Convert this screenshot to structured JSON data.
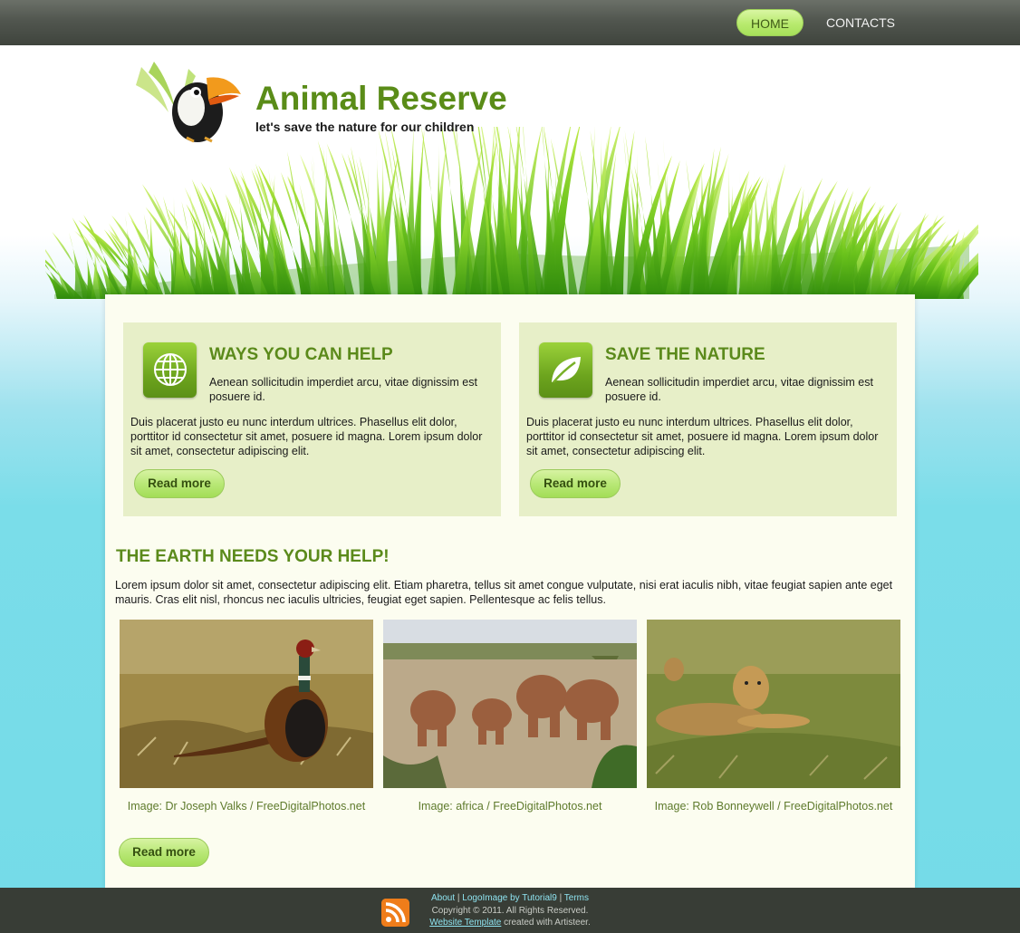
{
  "nav": {
    "home": "HOME",
    "contacts": "CONTACTS"
  },
  "header": {
    "title": "Animal Reserve",
    "slogan": "let's save the nature for our children",
    "logo_icon": "toucan-icon"
  },
  "boxes": [
    {
      "icon": "globe-icon",
      "title": "WAYS YOU CAN HELP",
      "lead": "Aenean sollicitudin imperdiet arcu, vitae dignissim est posuere id.",
      "body": "Duis placerat justo eu nunc interdum ultrices. Phasellus elit dolor, porttitor id consectetur sit amet, posuere id magna. Lorem ipsum dolor sit amet, consectetur adipiscing elit.",
      "button": "Read more"
    },
    {
      "icon": "leaf-icon",
      "title": "SAVE THE NATURE",
      "lead": "Aenean sollicitudin imperdiet arcu, vitae dignissim est posuere id.",
      "body": "Duis placerat justo eu nunc interdum ultrices. Phasellus elit dolor, porttitor id consectetur sit amet, posuere id magna. Lorem ipsum dolor sit amet, consectetur adipiscing elit.",
      "button": "Read more"
    }
  ],
  "section": {
    "title": "THE EARTH NEEDS YOUR HELP!",
    "text": "Lorem ipsum dolor sit amet, consectetur adipiscing elit. Etiam pharetra, tellus sit amet congue vulputate, nisi erat iaculis nibh, vitae feugiat sapien ante eget mauris. Cras elit nisl, rhoncus nec iaculis ultricies, feugiat eget sapien. Pellentesque ac felis tellus.",
    "photos": [
      {
        "subject": "pheasant",
        "caption": "Image: Dr Joseph Valks / FreeDigitalPhotos.net"
      },
      {
        "subject": "elephants",
        "caption": "Image: africa / FreeDigitalPhotos.net"
      },
      {
        "subject": "lions",
        "caption": "Image: Rob Bonneywell / FreeDigitalPhotos.net"
      }
    ],
    "button": "Read more"
  },
  "footer": {
    "about": "About",
    "sep1": " | ",
    "logo_credit": "LogoImage by Tutorial9",
    "sep2": " | ",
    "terms": "Terms",
    "copyright": "Copyright © 2011. All Rights Reserved.",
    "website_template": "Website Template",
    "created_with": " created with Artisteer.",
    "rss_icon": "rss-icon"
  },
  "colors": {
    "accent_green": "#5b8a1b",
    "button_green": "#b9e877",
    "topbar": "#51564f",
    "footer": "#383d36",
    "content_bg": "#fcfdf0",
    "box_bg": "#e7efc8"
  }
}
